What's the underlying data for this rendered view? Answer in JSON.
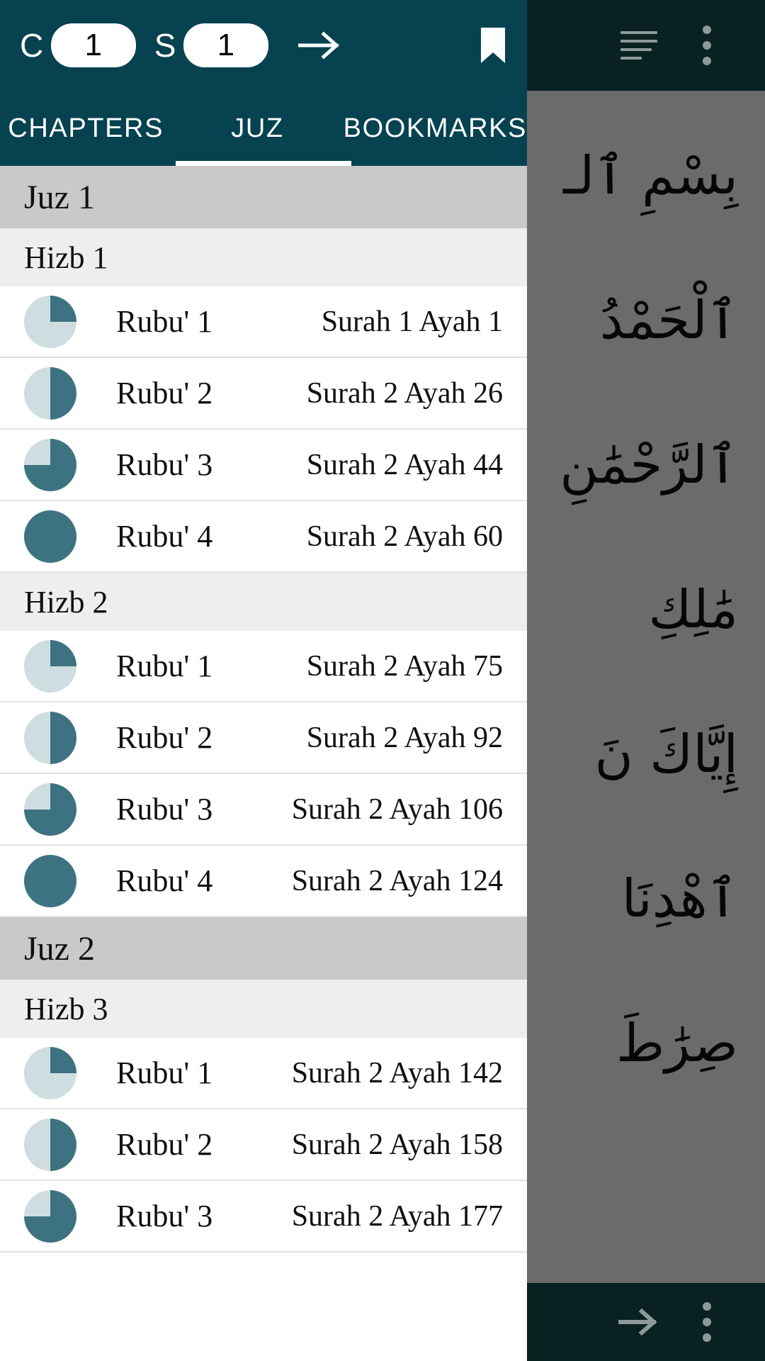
{
  "reader": {
    "topbar": {
      "list_icon": "list-view-icon",
      "menu_icon": "more-vert-icon"
    },
    "bottombar": {
      "next_icon": "arrow-right-icon",
      "menu_icon": "more-vert-icon"
    },
    "arabic_lines": [
      "بِسْمِ ٱلـ",
      "ٱلْحَمْدُ",
      "ٱلرَّحْمَٰنِ",
      "مَٰلِكِ",
      "إِيَّاكَ نَ",
      "ٱهْدِنَا",
      "صِرَٰطَ"
    ]
  },
  "drawer": {
    "controls": {
      "chapter_label": "C",
      "chapter_value": "1",
      "surah_label": "S",
      "surah_value": "1",
      "go_icon": "arrow-right-icon",
      "bookmark_icon": "bookmark-icon"
    },
    "tabs": [
      {
        "label": "CHAPTERS",
        "active": false
      },
      {
        "label": "JUZ",
        "active": true
      },
      {
        "label": "BOOKMARKS",
        "active": false
      }
    ],
    "colors": {
      "header_bg": "#064250",
      "juz_header_bg": "#c9c9c9",
      "hizb_header_bg": "#eeeeee",
      "pie_filled": "#3d7380",
      "pie_empty": "#cfdde1",
      "scrim": "#6b6b6b",
      "reader_bar": "#0a2121"
    },
    "sections": [
      {
        "juz": "Juz 1",
        "hizbs": [
          {
            "hizb": "Hizb 1",
            "rubus": [
              {
                "label": "Rubu' 1",
                "ref": "Surah 1 Ayah 1",
                "progress": 25
              },
              {
                "label": "Rubu' 2",
                "ref": "Surah 2 Ayah 26",
                "progress": 50
              },
              {
                "label": "Rubu' 3",
                "ref": "Surah 2 Ayah 44",
                "progress": 75
              },
              {
                "label": "Rubu' 4",
                "ref": "Surah 2 Ayah 60",
                "progress": 100
              }
            ]
          },
          {
            "hizb": "Hizb 2",
            "rubus": [
              {
                "label": "Rubu' 1",
                "ref": "Surah 2 Ayah 75",
                "progress": 25
              },
              {
                "label": "Rubu' 2",
                "ref": "Surah 2 Ayah 92",
                "progress": 50
              },
              {
                "label": "Rubu' 3",
                "ref": "Surah 2 Ayah 106",
                "progress": 75
              },
              {
                "label": "Rubu' 4",
                "ref": "Surah 2 Ayah 124",
                "progress": 100
              }
            ]
          }
        ]
      },
      {
        "juz": "Juz 2",
        "hizbs": [
          {
            "hizb": "Hizb 3",
            "rubus": [
              {
                "label": "Rubu' 1",
                "ref": "Surah 2 Ayah 142",
                "progress": 25
              },
              {
                "label": "Rubu' 2",
                "ref": "Surah 2 Ayah 158",
                "progress": 50
              },
              {
                "label": "Rubu' 3",
                "ref": "Surah 2 Ayah 177",
                "progress": 75
              }
            ]
          }
        ]
      }
    ]
  }
}
